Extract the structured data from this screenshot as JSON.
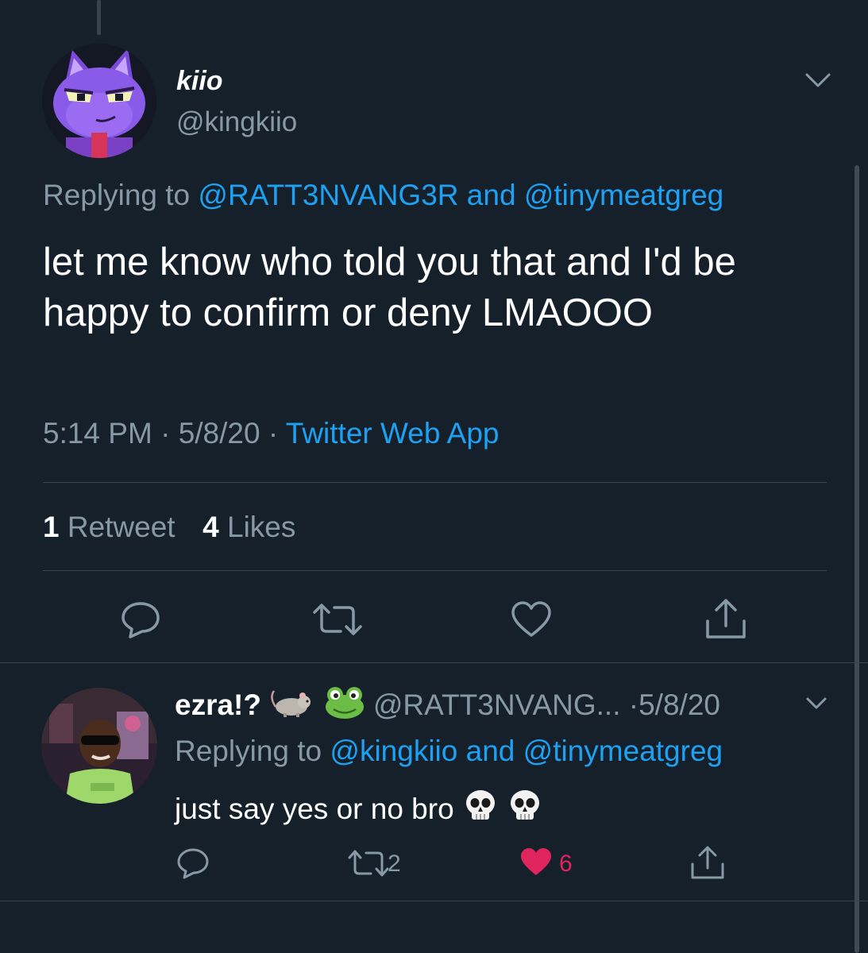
{
  "tweet": {
    "display_name": "kiio",
    "handle": "@kingkiio",
    "replying_prefix": "Replying to ",
    "replying_user1": "@RATT3NVANG3R",
    "replying_and": " and ",
    "replying_user2": "@tinymeatgreg",
    "text": "let me know who told you that and I'd be happy to confirm or deny LMAOOO",
    "time": "5:14 PM",
    "sep1": " · ",
    "date": "5/8/20",
    "sep2": " · ",
    "source": "Twitter Web App",
    "retweet_count": "1",
    "retweet_label": " Retweet",
    "like_count": "4",
    "like_label": " Likes"
  },
  "reply": {
    "display_name": "ezra!?",
    "handle": "@RATT3NVANG...",
    "date": " ·5/8/20",
    "replying_prefix": "Replying to ",
    "replying_user1": "@kingkiio",
    "replying_and": " and ",
    "replying_user2": "@tinymeatgreg",
    "text": "just say yes or no bro",
    "retweet_count": "2",
    "like_count": "6"
  },
  "colors": {
    "background": "#15202b",
    "text_primary": "#ffffff",
    "text_secondary": "#8899a6",
    "accent_blue": "#1da1f2",
    "like_red": "#e0245e",
    "divider": "#38444d"
  },
  "icons": {
    "reply": "reply-icon",
    "retweet": "retweet-icon",
    "like": "heart-icon",
    "share": "share-icon",
    "caret": "chevron-down-icon"
  }
}
